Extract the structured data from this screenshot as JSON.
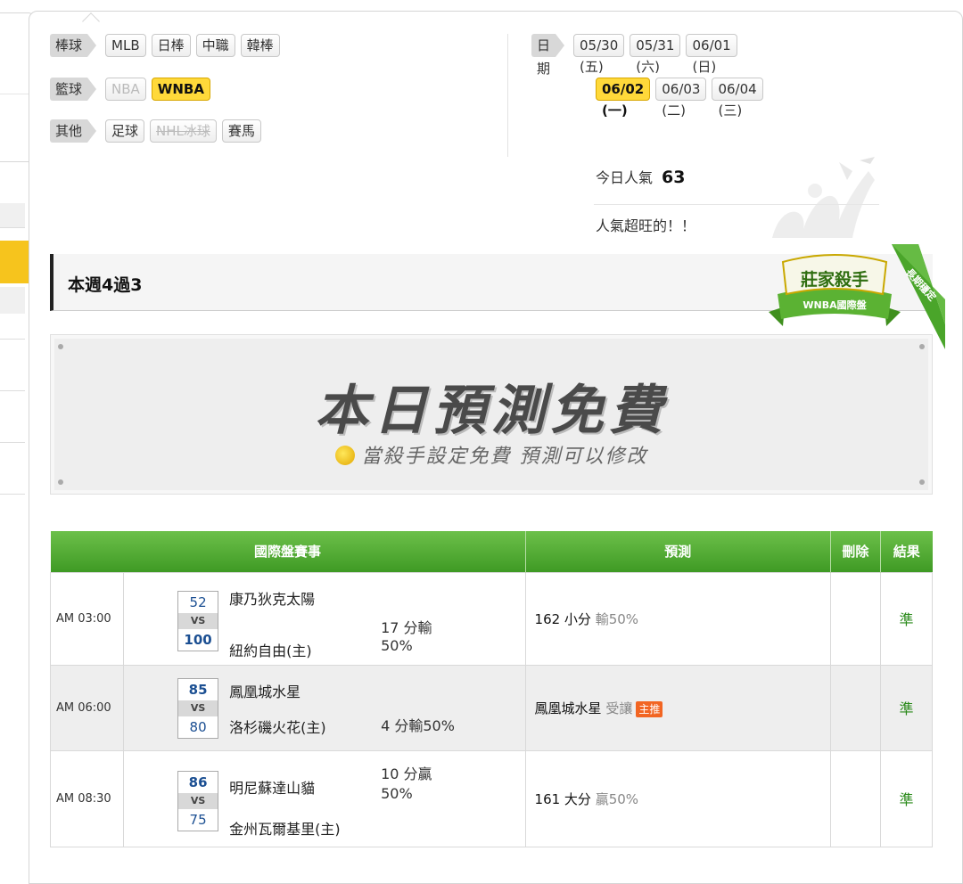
{
  "filters": {
    "baseball": {
      "label": "棒球",
      "items": [
        "MLB",
        "日棒",
        "中職",
        "韓棒"
      ]
    },
    "basketball": {
      "label": "籃球",
      "items": [
        "NBA",
        "WNBA"
      ],
      "active": "WNBA"
    },
    "other": {
      "label": "其他",
      "items": [
        "足球",
        "NHL冰球",
        "賽馬"
      ]
    }
  },
  "dates": {
    "label": "日期",
    "row1": [
      "05/30 (五)",
      "05/31 (六)",
      "06/01 (日)"
    ],
    "row2": [
      "06/02 (一)",
      "06/03 (二)",
      "06/04 (三)"
    ],
    "active": "06/02 (一)"
  },
  "popularity": {
    "label": "今日人氣",
    "value": "63",
    "message": "人氣超旺的！！"
  },
  "week": {
    "title": "本週4過3"
  },
  "badge": {
    "title": "莊家殺手",
    "subtitle": "WNBA國際盤",
    "ribbon": "長期穩定"
  },
  "banner": {
    "title": "本日預測免費",
    "subtitle": "當殺手設定免費 預測可以修改"
  },
  "table": {
    "headers": {
      "match": "國際盤賽事",
      "pick": "預測",
      "delete": "刪除",
      "result": "結果"
    },
    "rows": [
      {
        "time": "AM 03:00",
        "away_score": "52",
        "vs": "VS",
        "home_score": "100",
        "away": "康乃狄克太陽",
        "home": "紐約自由(主)",
        "handicap_1": "17 分輸",
        "handicap_2": "50%",
        "pick_main": "162 小分",
        "pick_extra": "輸50%",
        "result": "準"
      },
      {
        "time": "AM 06:00",
        "away_score": "85",
        "vs": "VS",
        "home_score": "80",
        "away": "鳳凰城水星",
        "home": "洛杉磯火花(主)",
        "handicap_1": "4 分輸50%",
        "pick_main": "鳳凰城水星",
        "pick_extra": "受讓",
        "pick_tag": "主推",
        "result": "準"
      },
      {
        "time": "AM 08:30",
        "away_score": "86",
        "vs": "VS",
        "home_score": "75",
        "away": "明尼蘇達山貓",
        "home": "金州瓦爾基里(主)",
        "handicap_1": "10 分贏",
        "handicap_2": "50%",
        "pick_main": "161 大分",
        "pick_extra": "贏50%",
        "result": "準"
      }
    ]
  },
  "colors": {
    "accent_green": "#4aaa2c",
    "active_yellow": "#ffd93a",
    "sidebar_tab": "#f6c41d",
    "result_green": "#2a8a1a",
    "tag_orange": "#f26522"
  }
}
